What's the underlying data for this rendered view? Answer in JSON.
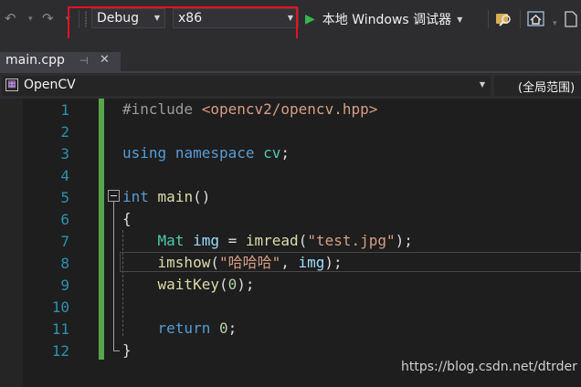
{
  "toolbar": {
    "configuration": "Debug",
    "platform": "x86",
    "run_label": "本地 Windows 调试器"
  },
  "tab": {
    "filename": "main.cpp",
    "pin_glyph": "⊣",
    "close_glyph": "✕"
  },
  "navbar": {
    "project": "OpenCV",
    "scope": "(全局范围)"
  },
  "editor": {
    "line_numbers": [
      "1",
      "2",
      "3",
      "4",
      "5",
      "6",
      "7",
      "8",
      "9",
      "10",
      "11",
      "12"
    ],
    "lines": {
      "l1_directive": "#include ",
      "l1_header": "<opencv2/opencv.hpp>",
      "l3_using": "using",
      "l3_namespace": "namespace",
      "l3_name": "cv",
      "l3_semi": ";",
      "l5_type": "int",
      "l5_func": "main",
      "l5_parens": "()",
      "l6_open": "{",
      "l7_type": "Mat",
      "l7_var": "img",
      "l7_eq": " = ",
      "l7_func": "imread",
      "l7_lp": "(",
      "l7_str": "\"test.jpg\"",
      "l7_rp": ");",
      "l8_func": "imshow",
      "l8_lp": "(",
      "l8_str": "\"哈哈哈\"",
      "l8_comma": ", ",
      "l8_var": "img",
      "l8_rp": ");",
      "l9_func": "waitKey",
      "l9_lp": "(",
      "l9_num": "0",
      "l9_rp": ");",
      "l11_return": "return",
      "l11_num": "0",
      "l11_semi": ";",
      "l12_close": "}"
    }
  },
  "watermark": "https://blog.csdn.net/dtrder",
  "icons": [
    "undo-icon",
    "redo-icon",
    "play-icon",
    "find-icon",
    "home-icon",
    "file-icon",
    "class-icon"
  ],
  "colors": {
    "keyword": "#569cd6",
    "string": "#d69d85",
    "function": "#dcdcaa",
    "type": "#4ec9b0",
    "line_number": "#2b91af",
    "change_bar": "#57a64a",
    "highlight_box": "#e81123"
  }
}
